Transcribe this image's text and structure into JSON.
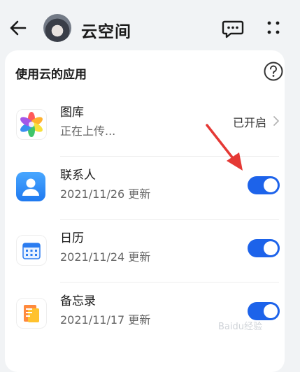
{
  "header": {
    "title": "云空间",
    "icons": [
      "back-arrow-icon",
      "avatar",
      "message-icon",
      "more-icon"
    ]
  },
  "section": {
    "title": "使用云的应用",
    "help_icon": "question-circle-icon"
  },
  "apps": [
    {
      "name": "图库",
      "subtitle": "正在上传...",
      "status": "已开启",
      "icon": "gallery-flower-icon"
    },
    {
      "name": "联系人",
      "subtitle": "2021/11/26 更新",
      "toggle_on": true,
      "icon": "contacts-person-icon"
    },
    {
      "name": "日历",
      "subtitle": "2021/11/24 更新",
      "toggle_on": true,
      "icon": "calendar-icon"
    },
    {
      "name": "备忘录",
      "subtitle": "2021/11/17 更新",
      "toggle_on": true,
      "icon": "notepad-icon"
    }
  ],
  "colors": {
    "accent": "#1d63ea",
    "background": "#f1f3f5",
    "card": "#ffffff"
  },
  "watermark": "Baidu经验"
}
